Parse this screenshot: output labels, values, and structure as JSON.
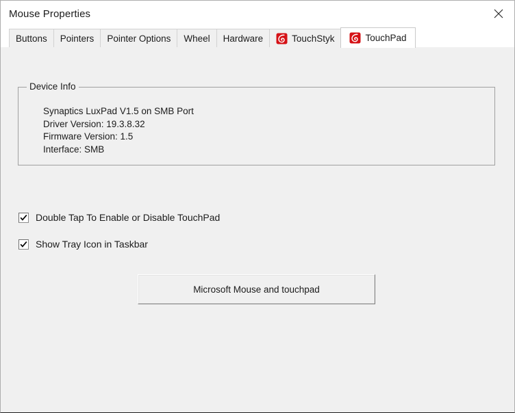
{
  "window": {
    "title": "Mouse Properties",
    "close_icon": "close-icon"
  },
  "tabs": [
    {
      "label": "Buttons",
      "icon": null,
      "active": false
    },
    {
      "label": "Pointers",
      "icon": null,
      "active": false
    },
    {
      "label": "Pointer Options",
      "icon": null,
      "active": false
    },
    {
      "label": "Wheel",
      "icon": null,
      "active": false
    },
    {
      "label": "Hardware",
      "icon": null,
      "active": false
    },
    {
      "label": "TouchStyk",
      "icon": "synaptics-icon",
      "active": false
    },
    {
      "label": "TouchPad",
      "icon": "synaptics-icon",
      "active": true
    }
  ],
  "device_info": {
    "legend": "Device Info",
    "lines": [
      "Synaptics LuxPad V1.5 on SMB Port",
      "Driver Version: 19.3.8.32",
      "Firmware Version: 1.5",
      "Interface: SMB"
    ]
  },
  "checkboxes": [
    {
      "label": "Double Tap To Enable or Disable TouchPad",
      "checked": true
    },
    {
      "label": "Show Tray Icon in Taskbar",
      "checked": true
    }
  ],
  "button": {
    "label": "Microsoft Mouse and touchpad"
  },
  "colors": {
    "accent_red": "#d51116",
    "content_bg": "#f0f0f0",
    "titlebar_bg": "#ffffff",
    "text": "#1b1b1b",
    "groupbox_border": "#a0a0a0"
  }
}
